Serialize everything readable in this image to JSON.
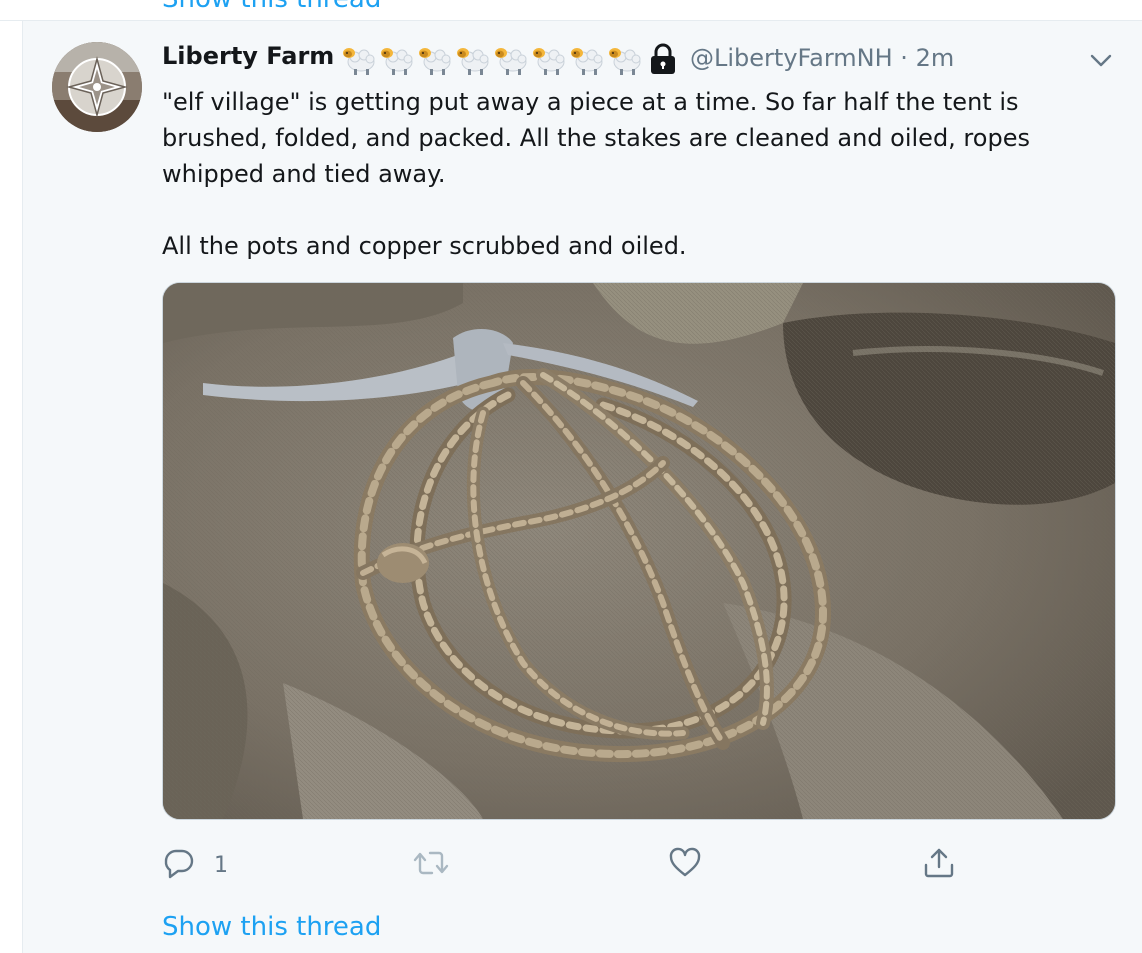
{
  "top_link": "Show this thread",
  "tweet": {
    "author_name": "Liberty Farm",
    "name_emoji": [
      "sheep-emoji",
      "sheep-emoji",
      "sheep-emoji",
      "sheep-emoji",
      "sheep-emoji",
      "sheep-emoji",
      "sheep-emoji",
      "sheep-emoji"
    ],
    "protected_icon": "lock-icon",
    "handle": "@LibertyFarmNH",
    "separator": "·",
    "time": "2m",
    "menu_icon": "chevron-down-icon",
    "text_paragraph_1": "\"elf village\" is getting put away a piece at a time. So far half the tent is brushed, folded, and packed. All the stakes are cleaned and oiled, ropes whipped and tied away.",
    "text_paragraph_2": "All the pots and copper scrubbed and oiled.",
    "media_description_icon": "photo-coiled-rope-on-canvas",
    "actions": {
      "reply_icon": "reply-icon",
      "reply_count": "1",
      "retweet_icon": "retweet-icon",
      "like_icon": "heart-icon",
      "share_icon": "share-icon"
    },
    "show_thread": "Show this thread"
  },
  "colors": {
    "link": "#1da1f2",
    "muted": "#657786",
    "text": "#14171a",
    "tweet_bg": "#f5f8fa",
    "retweet_disabled": "#aab8c2"
  }
}
